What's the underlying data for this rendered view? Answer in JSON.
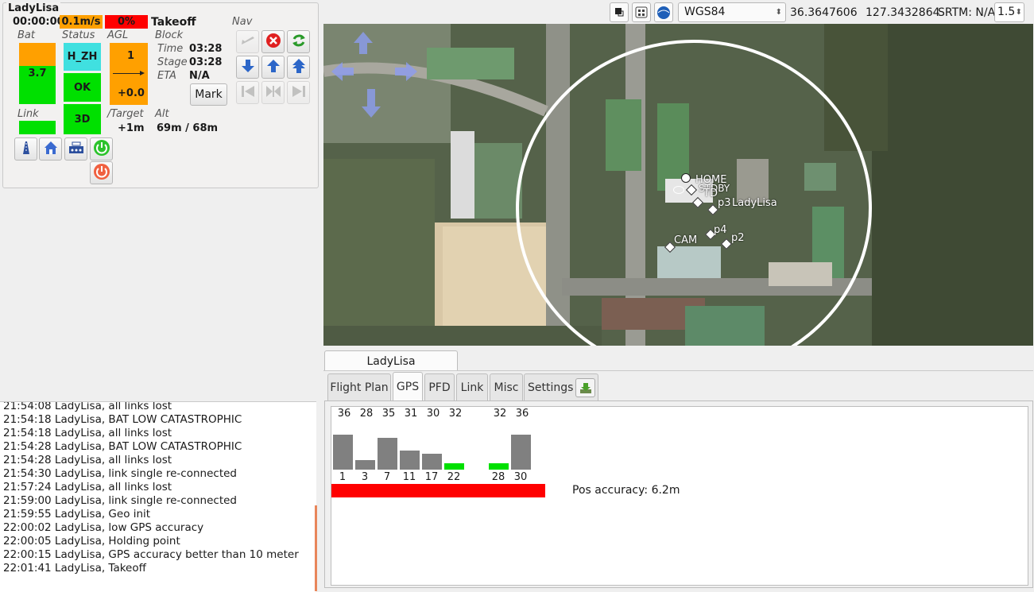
{
  "strip": {
    "aircraft_name": "LadyLisa",
    "flight_time": "00:00:00",
    "speed": "0.1m/s",
    "throttle": "0%",
    "block_name": "Takeoff",
    "labels": {
      "bat": "Bat",
      "status": "Status",
      "agl": "AGL",
      "block": "Block",
      "time": "Time",
      "stage": "Stage",
      "eta": "ETA",
      "link": "Link",
      "target": "/Target",
      "alt": "Alt",
      "nav": "Nav"
    },
    "bat_value": "3.7",
    "status_mode": "H_ZH",
    "status_ok": "OK",
    "status_gps": "3D",
    "agl_value": "1",
    "climb_value": "+0.0",
    "block_time": "03:28",
    "stage_time": "03:28",
    "eta": "N/A",
    "target": "+1m",
    "alt": "69m / 68m",
    "mark_label": "Mark",
    "colors": {
      "orange": "#ffa000",
      "green": "#00e000",
      "cyan": "#40e0e0",
      "red": "#ff0000"
    }
  },
  "log": [
    "21:54:08 LadyLisa, all links lost",
    "21:54:18 LadyLisa, BAT LOW CATASTROPHIC",
    "21:54:18 LadyLisa, all links lost",
    "21:54:28 LadyLisa, BAT LOW CATASTROPHIC",
    "21:54:28 LadyLisa, all links lost",
    "21:54:30 LadyLisa, link single re-connected",
    "21:57:24 LadyLisa, all links lost",
    "21:59:00 LadyLisa, link single re-connected",
    "21:59:55 LadyLisa, Geo init",
    "22:00:02 LadyLisa, low GPS accuracy",
    "22:00:05 LadyLisa, Holding point",
    "22:00:15 LadyLisa, GPS accuracy better than 10 meter",
    "22:01:41 LadyLisa, Takeoff"
  ],
  "toolbar": {
    "projection": "WGS84",
    "latitude": "36.3647606",
    "longitude": "127.3432864",
    "srtm": "SRTM: N/A",
    "zoom": "1.5"
  },
  "map": {
    "waypoints": [
      "HOME",
      "STDBY",
      "TD",
      "p3",
      "LadyLisa",
      "p4",
      "p2",
      "CAM"
    ]
  },
  "panel": {
    "aircraft_tab": "LadyLisa",
    "tabs": [
      "Flight Plan",
      "GPS",
      "PFD",
      "Link",
      "Misc",
      "Settings"
    ],
    "active_tab": "GPS"
  },
  "gps": {
    "satellites": [
      {
        "id": "1",
        "cn0": "36",
        "used": false
      },
      {
        "id": "3",
        "cn0": "28",
        "used": false
      },
      {
        "id": "7",
        "cn0": "35",
        "used": false
      },
      {
        "id": "11",
        "cn0": "31",
        "used": false
      },
      {
        "id": "17",
        "cn0": "30",
        "used": false
      },
      {
        "id": "22",
        "cn0": "32",
        "used": true
      },
      {
        "id": "28",
        "cn0": "32",
        "used": true
      },
      {
        "id": "30",
        "cn0": "36",
        "used": false
      }
    ],
    "pos_accuracy": "Pos accuracy: 6.2m",
    "accuracy_bar_color": "#ff0000"
  }
}
